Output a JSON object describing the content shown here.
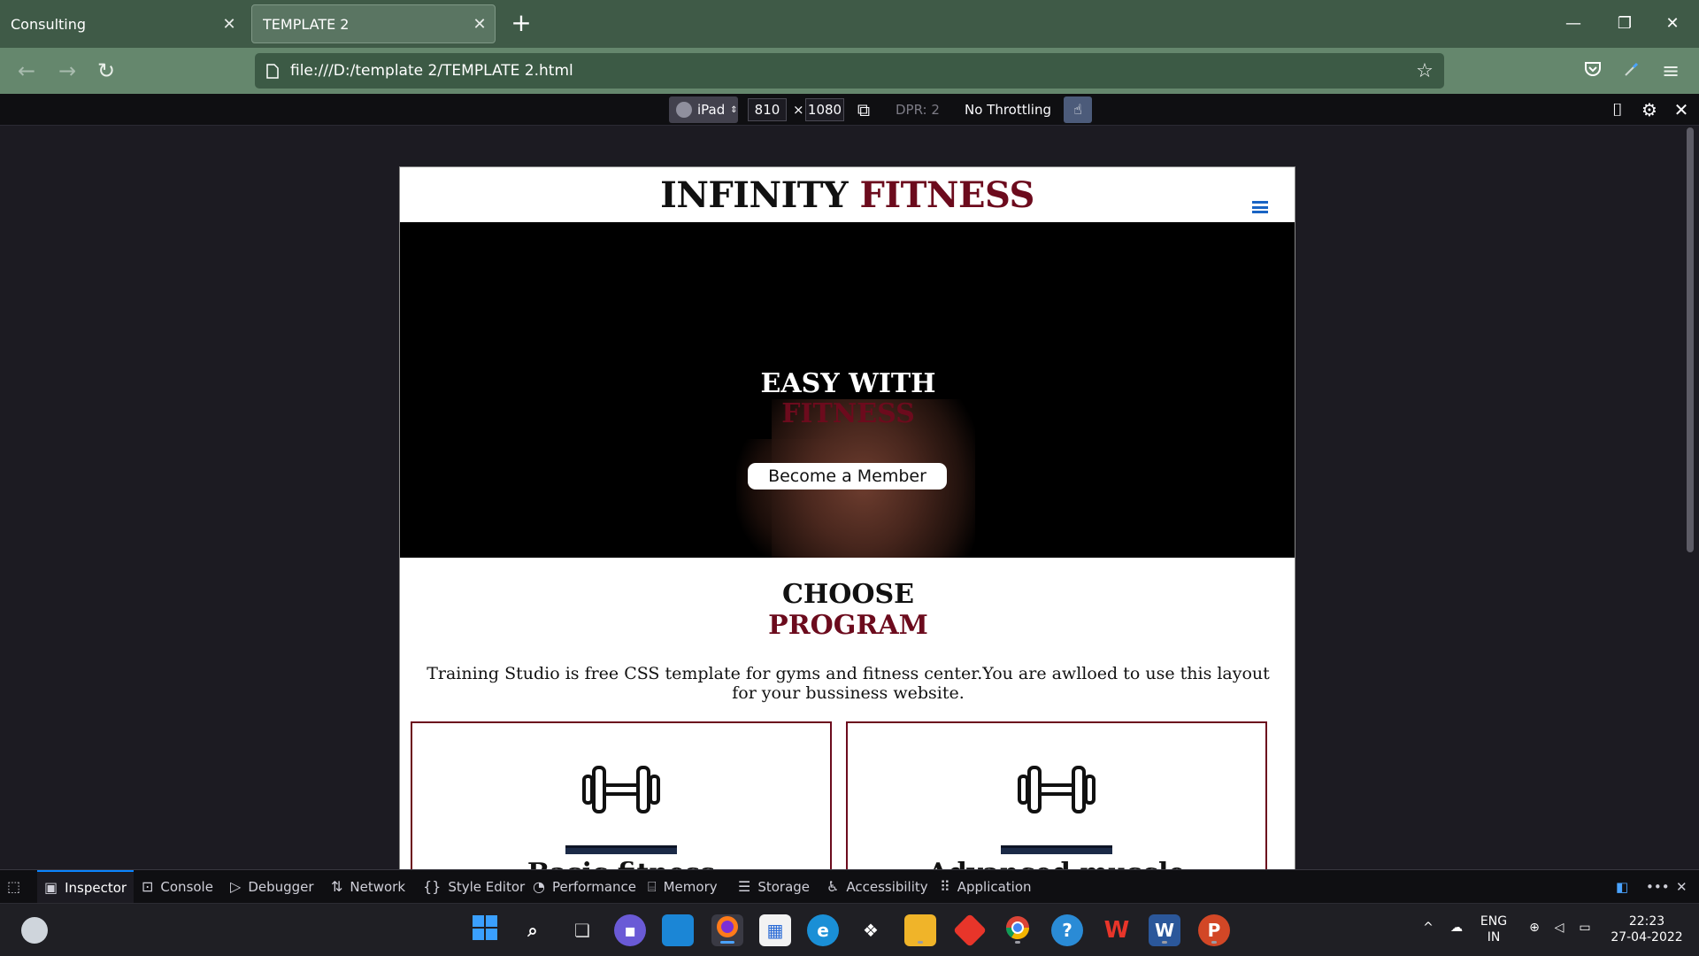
{
  "browser": {
    "tabs": [
      {
        "title": "Consulting"
      },
      {
        "title": "TEMPLATE 2"
      }
    ],
    "url": "file:///D:/template 2/TEMPLATE 2.html"
  },
  "rdm": {
    "device": "iPad",
    "width": "810",
    "times": "×",
    "height": "1080",
    "dpr": "DPR: 2",
    "throttling": "No Throttling"
  },
  "site": {
    "brand_main": "INFINITY",
    "brand_accent": "FITNESS",
    "hero_line1": "EASY WITH",
    "hero_line2": "FITNESS",
    "cta_label": "Become a Member",
    "program_line1": "CHOOSE",
    "program_line2": "PROGRAM",
    "program_desc": "Training Studio is free CSS template for gyms and fitness center.You are awlloed to use this layout for your bussiness website.",
    "cards": [
      {
        "title": "Basic fitness"
      },
      {
        "title": "Advanced muscle"
      }
    ],
    "colors": {
      "accent": "#6c0b1d",
      "menu": "#1a64c4"
    }
  },
  "devtools": {
    "tabs": [
      "Inspector",
      "Console",
      "Debugger",
      "Network",
      "Style Editor",
      "Performance",
      "Memory",
      "Storage",
      "Accessibility",
      "Application"
    ]
  },
  "taskbar": {
    "lang_top": "ENG",
    "lang_bottom": "IN",
    "time": "22:23",
    "date": "27-04-2022"
  }
}
